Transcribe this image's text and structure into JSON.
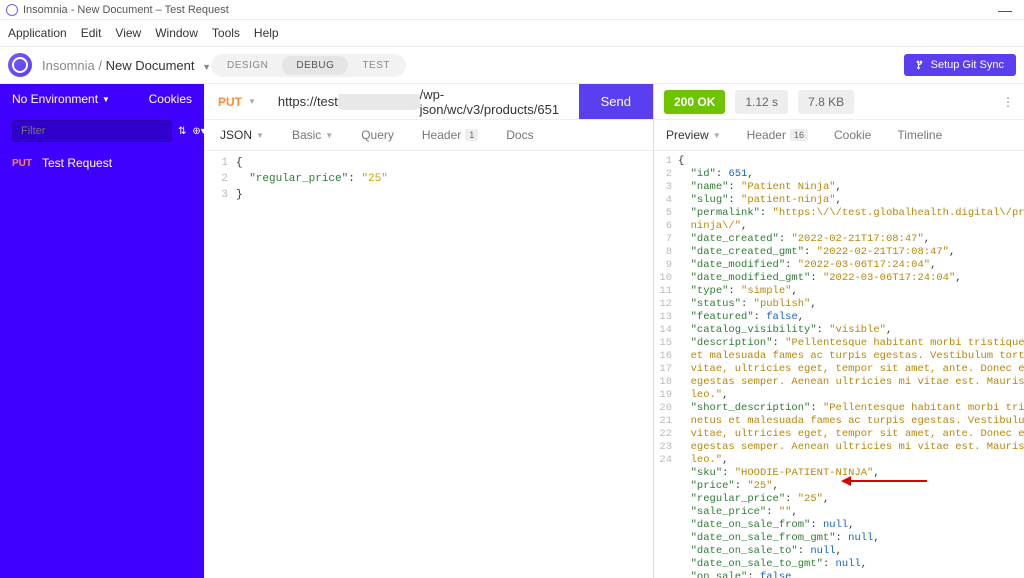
{
  "titlebar": {
    "title": "Insomnia - New Document – Test Request"
  },
  "menubar": [
    "Application",
    "Edit",
    "View",
    "Window",
    "Tools",
    "Help"
  ],
  "breadcrumb": {
    "root": "Insomnia",
    "current": "New Document"
  },
  "modes": {
    "design": "DESIGN",
    "debug": "DEBUG",
    "test": "TEST",
    "active": "debug"
  },
  "git_sync": "Setup Git Sync",
  "sidebar": {
    "env_label": "No Environment",
    "cookies_label": "Cookies",
    "filter_placeholder": "Filter",
    "items": [
      {
        "method": "PUT",
        "name": "Test Request"
      }
    ]
  },
  "request": {
    "method": "PUT",
    "url_pre": "https://test",
    "url_mask": "████████",
    "url_post": "/wp-json/wc/v3/products/651",
    "send": "Send",
    "body_tab": "JSON",
    "tabs": {
      "basic": "Basic",
      "query": "Query",
      "header": "Header",
      "header_badge": "1",
      "docs": "Docs"
    },
    "body_lines": [
      {
        "n": 1,
        "raw": "{"
      },
      {
        "n": 2,
        "raw": "  \"regular_price\": \"25\""
      },
      {
        "n": 3,
        "raw": "}"
      }
    ]
  },
  "response": {
    "status": "200 OK",
    "time": "1.12 s",
    "size": "7.8 KB",
    "preview_tab": "Preview",
    "tabs": {
      "header": "Header",
      "header_badge": "16",
      "cookie": "Cookie",
      "timeline": "Timeline"
    },
    "lines": [
      {
        "n": 1,
        "seg": [
          {
            "t": "{",
            "c": "brace"
          }
        ]
      },
      {
        "n": 2,
        "seg": [
          {
            "t": "  ",
            "c": ""
          },
          {
            "t": "\"id\"",
            "c": "key"
          },
          {
            "t": ": ",
            "c": ""
          },
          {
            "t": "651",
            "c": "num"
          },
          {
            "t": ",",
            "c": ""
          }
        ]
      },
      {
        "n": 3,
        "seg": [
          {
            "t": "  ",
            "c": ""
          },
          {
            "t": "\"name\"",
            "c": "key"
          },
          {
            "t": ": ",
            "c": ""
          },
          {
            "t": "\"Patient Ninja\"",
            "c": "yellow"
          },
          {
            "t": ",",
            "c": ""
          }
        ]
      },
      {
        "n": 4,
        "seg": [
          {
            "t": "  ",
            "c": ""
          },
          {
            "t": "\"slug\"",
            "c": "key"
          },
          {
            "t": ": ",
            "c": ""
          },
          {
            "t": "\"patient-ninja\"",
            "c": "yellow"
          },
          {
            "t": ",",
            "c": ""
          }
        ]
      },
      {
        "n": 5,
        "seg": [
          {
            "t": "  ",
            "c": ""
          },
          {
            "t": "\"permalink\"",
            "c": "key"
          },
          {
            "t": ": ",
            "c": ""
          },
          {
            "t": "\"https:\\/\\/test.globalhealth.digital\\/product\\/pat",
            "c": "yellow"
          }
        ]
      },
      {
        "n": 0,
        "seg": [
          {
            "t": "  ninja\\/\"",
            "c": "yellow"
          },
          {
            "t": ",",
            "c": ""
          }
        ]
      },
      {
        "n": 6,
        "seg": [
          {
            "t": "  ",
            "c": ""
          },
          {
            "t": "\"date_created\"",
            "c": "key"
          },
          {
            "t": ": ",
            "c": ""
          },
          {
            "t": "\"2022-02-21T17:08:47\"",
            "c": "yellow"
          },
          {
            "t": ",",
            "c": ""
          }
        ]
      },
      {
        "n": 7,
        "seg": [
          {
            "t": "  ",
            "c": ""
          },
          {
            "t": "\"date_created_gmt\"",
            "c": "key"
          },
          {
            "t": ": ",
            "c": ""
          },
          {
            "t": "\"2022-02-21T17:08:47\"",
            "c": "yellow"
          },
          {
            "t": ",",
            "c": ""
          }
        ]
      },
      {
        "n": 8,
        "seg": [
          {
            "t": "  ",
            "c": ""
          },
          {
            "t": "\"date_modified\"",
            "c": "key"
          },
          {
            "t": ": ",
            "c": ""
          },
          {
            "t": "\"2022-03-06T17:24:04\"",
            "c": "yellow"
          },
          {
            "t": ",",
            "c": ""
          }
        ]
      },
      {
        "n": 9,
        "seg": [
          {
            "t": "  ",
            "c": ""
          },
          {
            "t": "\"date_modified_gmt\"",
            "c": "key"
          },
          {
            "t": ": ",
            "c": ""
          },
          {
            "t": "\"2022-03-06T17:24:04\"",
            "c": "yellow"
          },
          {
            "t": ",",
            "c": ""
          }
        ]
      },
      {
        "n": 10,
        "seg": [
          {
            "t": "  ",
            "c": ""
          },
          {
            "t": "\"type\"",
            "c": "key"
          },
          {
            "t": ": ",
            "c": ""
          },
          {
            "t": "\"simple\"",
            "c": "yellow"
          },
          {
            "t": ",",
            "c": ""
          }
        ]
      },
      {
        "n": 11,
        "seg": [
          {
            "t": "  ",
            "c": ""
          },
          {
            "t": "\"status\"",
            "c": "key"
          },
          {
            "t": ": ",
            "c": ""
          },
          {
            "t": "\"publish\"",
            "c": "yellow"
          },
          {
            "t": ",",
            "c": ""
          }
        ]
      },
      {
        "n": 12,
        "seg": [
          {
            "t": "  ",
            "c": ""
          },
          {
            "t": "\"featured\"",
            "c": "key"
          },
          {
            "t": ": ",
            "c": ""
          },
          {
            "t": "false",
            "c": "bool"
          },
          {
            "t": ",",
            "c": ""
          }
        ]
      },
      {
        "n": 13,
        "seg": [
          {
            "t": "  ",
            "c": ""
          },
          {
            "t": "\"catalog_visibility\"",
            "c": "key"
          },
          {
            "t": ": ",
            "c": ""
          },
          {
            "t": "\"visible\"",
            "c": "yellow"
          },
          {
            "t": ",",
            "c": ""
          }
        ]
      },
      {
        "n": 14,
        "seg": [
          {
            "t": "  ",
            "c": ""
          },
          {
            "t": "\"description\"",
            "c": "key"
          },
          {
            "t": ": ",
            "c": ""
          },
          {
            "t": "\"Pellentesque habitant morbi tristique senectus",
            "c": "yellow"
          }
        ]
      },
      {
        "n": 0,
        "seg": [
          {
            "t": "  et malesuada fames ac turpis egestas. Vestibulum tortor quam, feu",
            "c": "yellow"
          }
        ]
      },
      {
        "n": 0,
        "seg": [
          {
            "t": "  vitae, ultricies eget, tempor sit amet, ante. Donec eu libero sit",
            "c": "yellow"
          }
        ]
      },
      {
        "n": 0,
        "seg": [
          {
            "t": "  egestas semper. Aenean ultricies mi vitae est. Mauris placerat el",
            "c": "yellow"
          }
        ]
      },
      {
        "n": 0,
        "seg": [
          {
            "t": "  leo.\"",
            "c": "yellow"
          },
          {
            "t": ",",
            "c": ""
          }
        ]
      },
      {
        "n": 15,
        "seg": [
          {
            "t": "  ",
            "c": ""
          },
          {
            "t": "\"short_description\"",
            "c": "key"
          },
          {
            "t": ": ",
            "c": ""
          },
          {
            "t": "\"Pellentesque habitant morbi tristique se",
            "c": "yellow"
          }
        ]
      },
      {
        "n": 0,
        "seg": [
          {
            "t": "  netus et malesuada fames ac turpis egestas. Vestibulum tortor qua",
            "c": "yellow"
          }
        ]
      },
      {
        "n": 0,
        "seg": [
          {
            "t": "  vitae, ultricies eget, tempor sit amet, ante. Donec eu libero sit",
            "c": "yellow"
          }
        ]
      },
      {
        "n": 0,
        "seg": [
          {
            "t": "  egestas semper. Aenean ultricies mi vitae est. Mauris placerat el",
            "c": "yellow"
          }
        ]
      },
      {
        "n": 0,
        "seg": [
          {
            "t": "  leo.\"",
            "c": "yellow"
          },
          {
            "t": ",",
            "c": ""
          }
        ]
      },
      {
        "n": 16,
        "seg": [
          {
            "t": "  ",
            "c": ""
          },
          {
            "t": "\"sku\"",
            "c": "key"
          },
          {
            "t": ": ",
            "c": ""
          },
          {
            "t": "\"HOODIE-PATIENT-NINJA\"",
            "c": "yellow"
          },
          {
            "t": ",",
            "c": ""
          }
        ]
      },
      {
        "n": 17,
        "seg": [
          {
            "t": "  ",
            "c": ""
          },
          {
            "t": "\"price\"",
            "c": "key"
          },
          {
            "t": ": ",
            "c": ""
          },
          {
            "t": "\"25\"",
            "c": "yellow"
          },
          {
            "t": ",",
            "c": ""
          }
        ]
      },
      {
        "n": 18,
        "seg": [
          {
            "t": "  ",
            "c": ""
          },
          {
            "t": "\"regular_price\"",
            "c": "key"
          },
          {
            "t": ": ",
            "c": ""
          },
          {
            "t": "\"25\"",
            "c": "yellow"
          },
          {
            "t": ",",
            "c": ""
          }
        ]
      },
      {
        "n": 19,
        "seg": [
          {
            "t": "  ",
            "c": ""
          },
          {
            "t": "\"sale_price\"",
            "c": "key"
          },
          {
            "t": ": ",
            "c": ""
          },
          {
            "t": "\"\"",
            "c": "yellow"
          },
          {
            "t": ",",
            "c": ""
          }
        ]
      },
      {
        "n": 20,
        "seg": [
          {
            "t": "  ",
            "c": ""
          },
          {
            "t": "\"date_on_sale_from\"",
            "c": "key"
          },
          {
            "t": ": ",
            "c": ""
          },
          {
            "t": "null",
            "c": "null"
          },
          {
            "t": ",",
            "c": ""
          }
        ]
      },
      {
        "n": 21,
        "seg": [
          {
            "t": "  ",
            "c": ""
          },
          {
            "t": "\"date_on_sale_from_gmt\"",
            "c": "key"
          },
          {
            "t": ": ",
            "c": ""
          },
          {
            "t": "null",
            "c": "null"
          },
          {
            "t": ",",
            "c": ""
          }
        ]
      },
      {
        "n": 22,
        "seg": [
          {
            "t": "  ",
            "c": ""
          },
          {
            "t": "\"date_on_sale_to\"",
            "c": "key"
          },
          {
            "t": ": ",
            "c": ""
          },
          {
            "t": "null",
            "c": "null"
          },
          {
            "t": ",",
            "c": ""
          }
        ]
      },
      {
        "n": 23,
        "seg": [
          {
            "t": "  ",
            "c": ""
          },
          {
            "t": "\"date_on_sale_to_gmt\"",
            "c": "key"
          },
          {
            "t": ": ",
            "c": ""
          },
          {
            "t": "null",
            "c": "null"
          },
          {
            "t": ",",
            "c": ""
          }
        ]
      },
      {
        "n": 24,
        "seg": [
          {
            "t": "  ",
            "c": ""
          },
          {
            "t": "\"on_sale\"",
            "c": "key"
          },
          {
            "t": ": ",
            "c": ""
          },
          {
            "t": "false",
            "c": "bool"
          }
        ]
      }
    ]
  }
}
